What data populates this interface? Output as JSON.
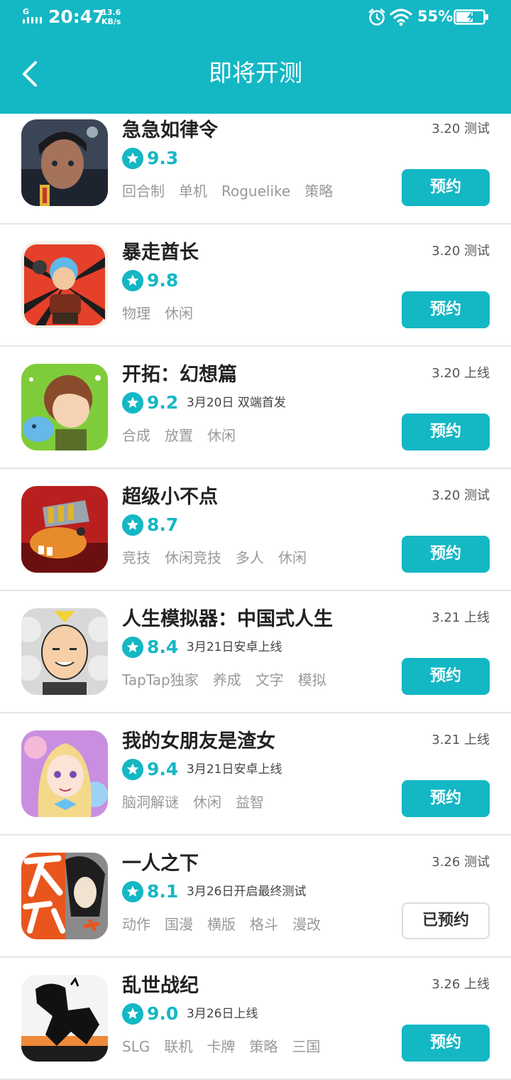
{
  "status_bar": {
    "network": "G",
    "time": "20:47",
    "speed_value": "13.6",
    "speed_unit": "KB/s",
    "battery_pct": "55%"
  },
  "header": {
    "title": "即将开测"
  },
  "colors": {
    "accent": "#14b7c4"
  },
  "games": [
    {
      "name": "急急如律令",
      "date": "3.20 测试",
      "score": "9.3",
      "note": "",
      "tags": [
        "回合制",
        "单机",
        "Roguelike",
        "策略"
      ],
      "button": "预约",
      "reserved": false
    },
    {
      "name": "暴走酋长",
      "date": "3.20 测试",
      "score": "9.8",
      "note": "",
      "tags": [
        "物理",
        "休闲"
      ],
      "button": "预约",
      "reserved": false
    },
    {
      "name": "开拓：幻想篇",
      "date": "3.20 上线",
      "score": "9.2",
      "note": "3月20日 双端首发",
      "tags": [
        "合成",
        "放置",
        "休闲"
      ],
      "button": "预约",
      "reserved": false
    },
    {
      "name": "超级小不点",
      "date": "3.20 测试",
      "score": "8.7",
      "note": "",
      "tags": [
        "竞技",
        "休闲竞技",
        "多人",
        "休闲"
      ],
      "button": "预约",
      "reserved": false
    },
    {
      "name": "人生模拟器：中国式人生",
      "date": "3.21 上线",
      "score": "8.4",
      "note": "3月21日安卓上线",
      "tags": [
        "TapTap独家",
        "养成",
        "文字",
        "模拟"
      ],
      "button": "预约",
      "reserved": false
    },
    {
      "name": "我的女朋友是渣女",
      "date": "3.21 上线",
      "score": "9.4",
      "note": "3月21日安卓上线",
      "tags": [
        "脑洞解谜",
        "休闲",
        "益智"
      ],
      "button": "预约",
      "reserved": false
    },
    {
      "name": "一人之下",
      "date": "3.26 测试",
      "score": "8.1",
      "note": "3月26日开启最终测试",
      "tags": [
        "动作",
        "国漫",
        "横版",
        "格斗",
        "漫改"
      ],
      "button": "已预约",
      "reserved": true
    },
    {
      "name": "乱世战纪",
      "date": "3.26 上线",
      "score": "9.0",
      "note": "3月26日上线",
      "tags": [
        "SLG",
        "联机",
        "卡牌",
        "策略",
        "三国"
      ],
      "button": "预约",
      "reserved": false
    }
  ]
}
